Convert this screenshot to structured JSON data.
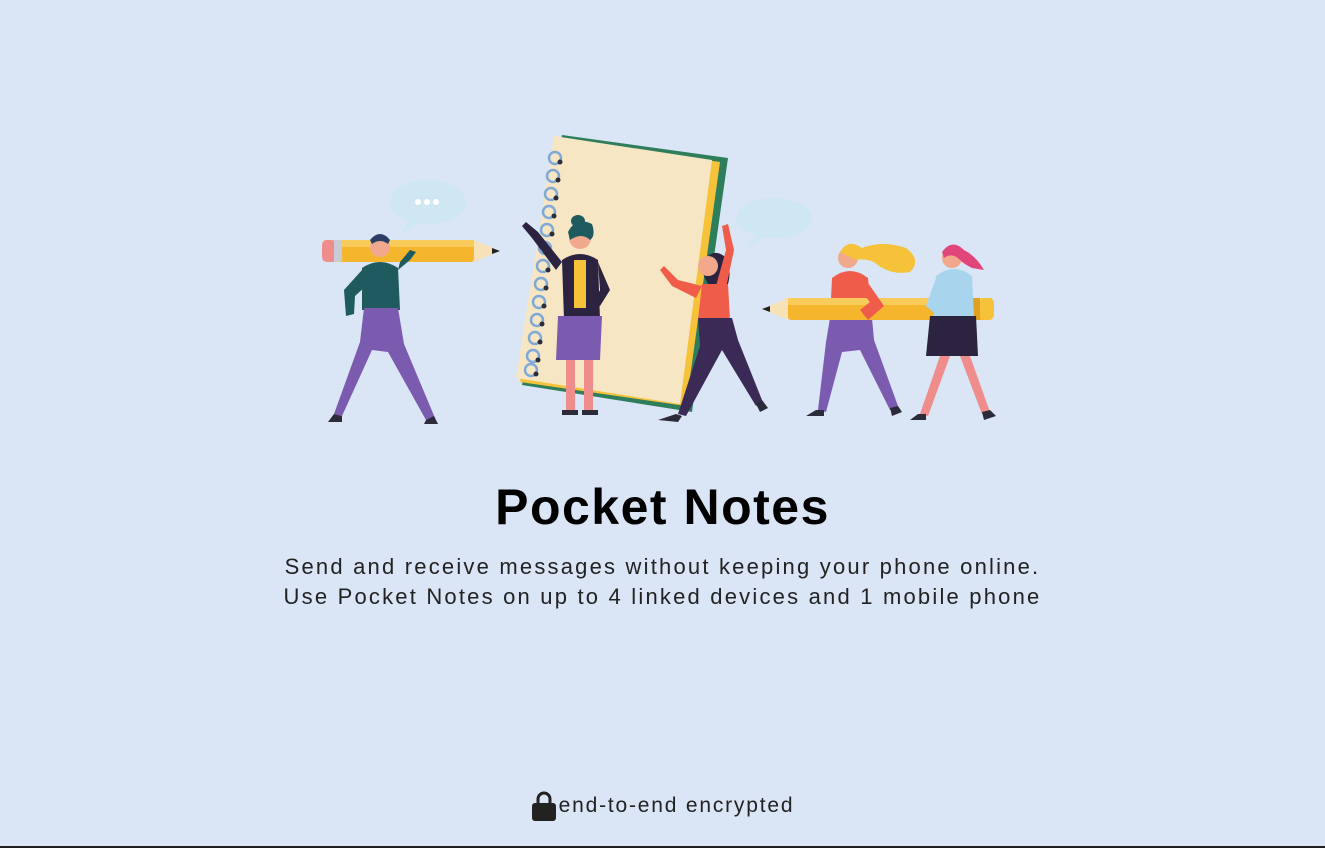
{
  "hero": {
    "illustration_icon": "notebook-people-illustration-icon"
  },
  "app": {
    "title": "Pocket Notes",
    "subtitle_line1": "Send and receive messages without keeping your phone online.",
    "subtitle_line2": "Use Pocket Notes on up to 4 linked devices and 1 mobile phone"
  },
  "footer": {
    "lock_icon": "lock-icon",
    "text": "end-to-end encrypted"
  },
  "colors": {
    "background": "#DAE5F5",
    "notebook": "#F7E6C4",
    "pencil": "#F5B52D",
    "purple": "#7B5BB0",
    "dark_teal": "#1F5A5F",
    "coral": "#EF5D4A",
    "dark_purple": "#3A2A55"
  }
}
